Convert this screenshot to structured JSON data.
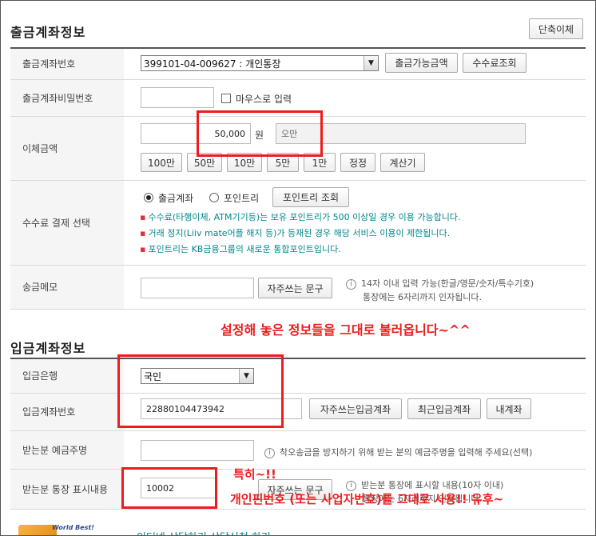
{
  "withdraw": {
    "title": "출금계좌정보",
    "direct_transfer_button": "단축이체",
    "account_label": "출금계좌번호",
    "account_selected": "399101-04-009627 : 개인통장",
    "available_button": "출금가능금액",
    "fee_button": "수수료조회",
    "password_label": "출금계좌비밀번호",
    "mouse_input_label": "마우스로 입력",
    "amount_label": "이체금액",
    "amount_value": "50,000",
    "amount_unit": "원",
    "amount_korean": "오만",
    "quick_amounts": [
      "100만",
      "50만",
      "10만",
      "5만",
      "1만",
      "정정",
      "계산기"
    ],
    "fee_payment_label": "수수료 결제 선택",
    "radio_account": "출금계좌",
    "radio_point": "포인트리",
    "point_lookup_button": "포인트리 조회",
    "fee_notes": [
      "수수료(타행이체, ATM기기등)는 보유 포인트리가 500 이상일 경우 이용 가능합니다.",
      "거래 정지(Liiv mate어플 해지 등)가 등재된 경우 해당 서비스 이용이 제한됩니다.",
      "포인트리는 KB금융그룹의 새로운 통합포인트입니다."
    ],
    "memo_label": "송금메모",
    "frequent_phrase_button": "자주쓰는 문구",
    "memo_note_1": "14자 이내 입력 가능(한글/영문/숫자/특수기호)",
    "memo_note_2": "통장에는 6자리까지 인자됩니다."
  },
  "deposit": {
    "title": "입금계좌정보",
    "bank_label": "입금은행",
    "bank_selected": "국민",
    "account_label": "입금계좌번호",
    "account_value": "22880104473942",
    "frequent_account_button": "자주쓰는입금계좌",
    "recent_account_button": "최근입금계좌",
    "my_account_button": "내계좌",
    "holder_label": "받는분 예금주명",
    "holder_note": "착오송금을 방지하기 위해 받는 분의 예금주명을 입력해 주세요(선택)",
    "display_label": "받는분 통장 표시내용",
    "display_value": "10002",
    "frequent_phrase_button": "자주쓰는 문구",
    "display_note_1": "받는분 통장에 표시할 내용(10자 이내)",
    "display_note_2": "통장에는 6자리까지 인자됩니다."
  },
  "annotations": {
    "loaded_settings": "설정해 놓은 정보들을 그대로 불러옵니다~^^",
    "especially": "특히~!!",
    "pin_note": "개인핀번호 (또는 사업자번호)를 그대로 사용!! 유후~"
  },
  "banner": {
    "badge_text": "World Best!",
    "link_text": "인터넷 상담하기 상담신청 하기"
  },
  "colors": {
    "annotation_red": "#ee1c1c",
    "note_teal": "#00878e"
  }
}
